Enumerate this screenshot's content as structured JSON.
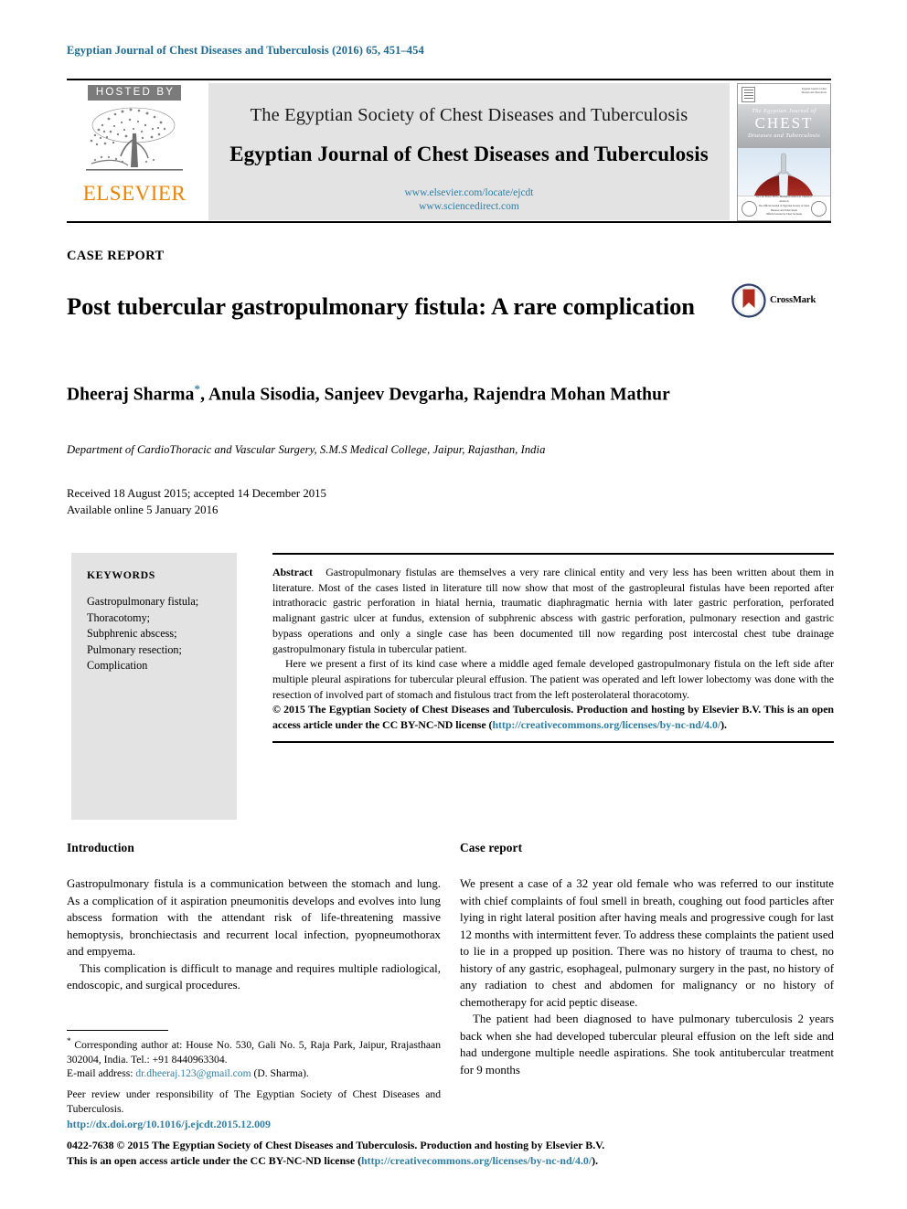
{
  "running_head": "Egyptian Journal of Chest Diseases and Tuberculosis (2016) 65, 451–454",
  "masthead": {
    "hosted_by": "HOSTED BY",
    "publisher": "ELSEVIER",
    "society_line": "The Egyptian Society of Chest Diseases and Tuberculosis",
    "journal_line": "Egyptian Journal of Chest Diseases and Tuberculosis",
    "url_1": "www.elsevier.com/locate/ejcdt",
    "url_2": "www.sciencedirect.com",
    "cover": {
      "line1": "The Egyptian Journal of",
      "line2": "CHEST",
      "line3": "Diseases and Tuberculosis",
      "footer1": "Incl. in: Ebsco, B.I.S., Biological Abstracts, Chemical Abstracts",
      "footer2": "The Official Journal of Egyptian Society of Chest Diseases and Tuberculosis",
      "footer3": "Official Journal for Chest Societies",
      "topright1": "Egyptian Journal of Chest",
      "topright2": "Diseases and Tuberculosis"
    }
  },
  "article": {
    "type_label": "CASE REPORT",
    "title": "Post tubercular gastropulmonary fistula: A rare complication",
    "crossmark_label": "CrossMark",
    "authors": "Dheeraj Sharma , Anula Sisodia, Sanjeev Devgarha, Rajendra Mohan Mathur",
    "author_names_pre": "Dheeraj Sharma",
    "author_names_post": ", Anula Sisodia, Sanjeev Devgarha, Rajendra Mohan Mathur",
    "corresponding_marker": "*",
    "affiliation": "Department of CardioThoracic and Vascular Surgery, S.M.S Medical College, Jaipur, Rajasthan, India",
    "received_line": "Received 18 August 2015; accepted 14 December 2015",
    "available_line": "Available online 5 January 2016"
  },
  "keywords": {
    "heading": "KEYWORDS",
    "items": "Gastropulmonary fistula; Thoracotomy; Subphrenic abscess; Pulmonary resection; Complication",
    "list": [
      "Gastropulmonary fistula;",
      "Thoracotomy;",
      "Subphrenic abscess;",
      "Pulmonary resection;",
      "Complication"
    ]
  },
  "abstract": {
    "label": "Abstract",
    "paragraph_1": "Gastropulmonary fistulas are themselves a very rare clinical entity and very less has been written about them in literature. Most of the cases listed in literature till now show that most of the gastropleural fistulas have been reported after intrathoracic gastric perforation in hiatal hernia, traumatic diaphragmatic hernia with later gastric perforation, perforated malignant gastric ulcer at fundus, extension of subphrenic abscess with gastric perforation, pulmonary resection and gastric bypass operations and only a single case has been documented till now regarding post intercostal chest tube drainage gastropulmonary fistula in tubercular patient.",
    "paragraph_2": "Here we present a first of its kind case where a middle aged female developed gastropulmonary fistula on the left side after multiple pleural aspirations for tubercular pleural effusion. The patient was operated and left lower lobectomy was done with the resection of involved part of stomach and fistulous tract from the left posterolateral thoracotomy.",
    "copyright_text": "© 2015 The Egyptian Society of Chest Diseases and Tuberculosis. Production and hosting by Elsevier B.V. This is an open access article under the CC BY-NC-ND license (",
    "copyright_link": "http://creativecommons.org/licenses/by-nc-nd/4.0/",
    "copyright_tail": ")."
  },
  "sections": {
    "introduction": {
      "heading": "Introduction",
      "paragraph_1": "Gastropulmonary fistula is a communication between the stomach and lung. As a complication of it aspiration pneumonitis develops and evolves into lung abscess formation with the attendant risk of life-threatening massive hemoptysis, bronchiectasis and recurrent local infection, pyopneumothorax and empyema.",
      "paragraph_2": "This complication is difficult to manage and requires multiple radiological, endoscopic, and surgical procedures."
    },
    "case_report": {
      "heading": "Case report",
      "paragraph_1": "We present a case of a 32 year old female who was referred to our institute with chief complaints of foul smell in breath, coughing out food particles after lying in right lateral position after having meals and progressive cough for last 12 months with intermittent fever. To address these complaints the patient used to lie in a propped up position. There was no history of trauma to chest, no history of any gastric, esophageal, pulmonary surgery in the past, no history of any radiation to chest and abdomen for malignancy or no history of chemotherapy for acid peptic disease.",
      "paragraph_2": "The patient had been diagnosed to have pulmonary tuberculosis 2 years back when she had developed tubercular pleural effusion on the left side and had undergone multiple needle aspirations. She took antitubercular treatment for 9 months"
    }
  },
  "footnotes": {
    "corresponding_marker": "*",
    "corresponding": "Corresponding author at: House No. 530, Gali No. 5, Raja Park, Jaipur, Rrajasthaan 302004, India. Tel.: +91 8440963304.",
    "email_label": "E-mail address:",
    "email": "dr.dheeraj.123@gmail.com",
    "email_suffix": "(D. Sharma).",
    "peer_review": "Peer review under responsibility of The Egyptian Society of Chest Diseases and Tuberculosis.",
    "doi": "http://dx.doi.org/10.1016/j.ejcdt.2015.12.009"
  },
  "page_footer": {
    "line_1": "0422-7638 © 2015 The Egyptian Society of Chest Diseases and Tuberculosis. Production and hosting by Elsevier B.V.",
    "line_2_pre": "This is an open access article under the CC BY-NC-ND license (",
    "line_2_link": "http://creativecommons.org/licenses/by-nc-nd/4.0/",
    "line_2_post": ")."
  },
  "colors": {
    "link": "#2e7fa8",
    "elsevier_orange": "#ee8300",
    "hosted_gray": "#7b7b7b",
    "panel_gray": "#e3e3e3"
  }
}
